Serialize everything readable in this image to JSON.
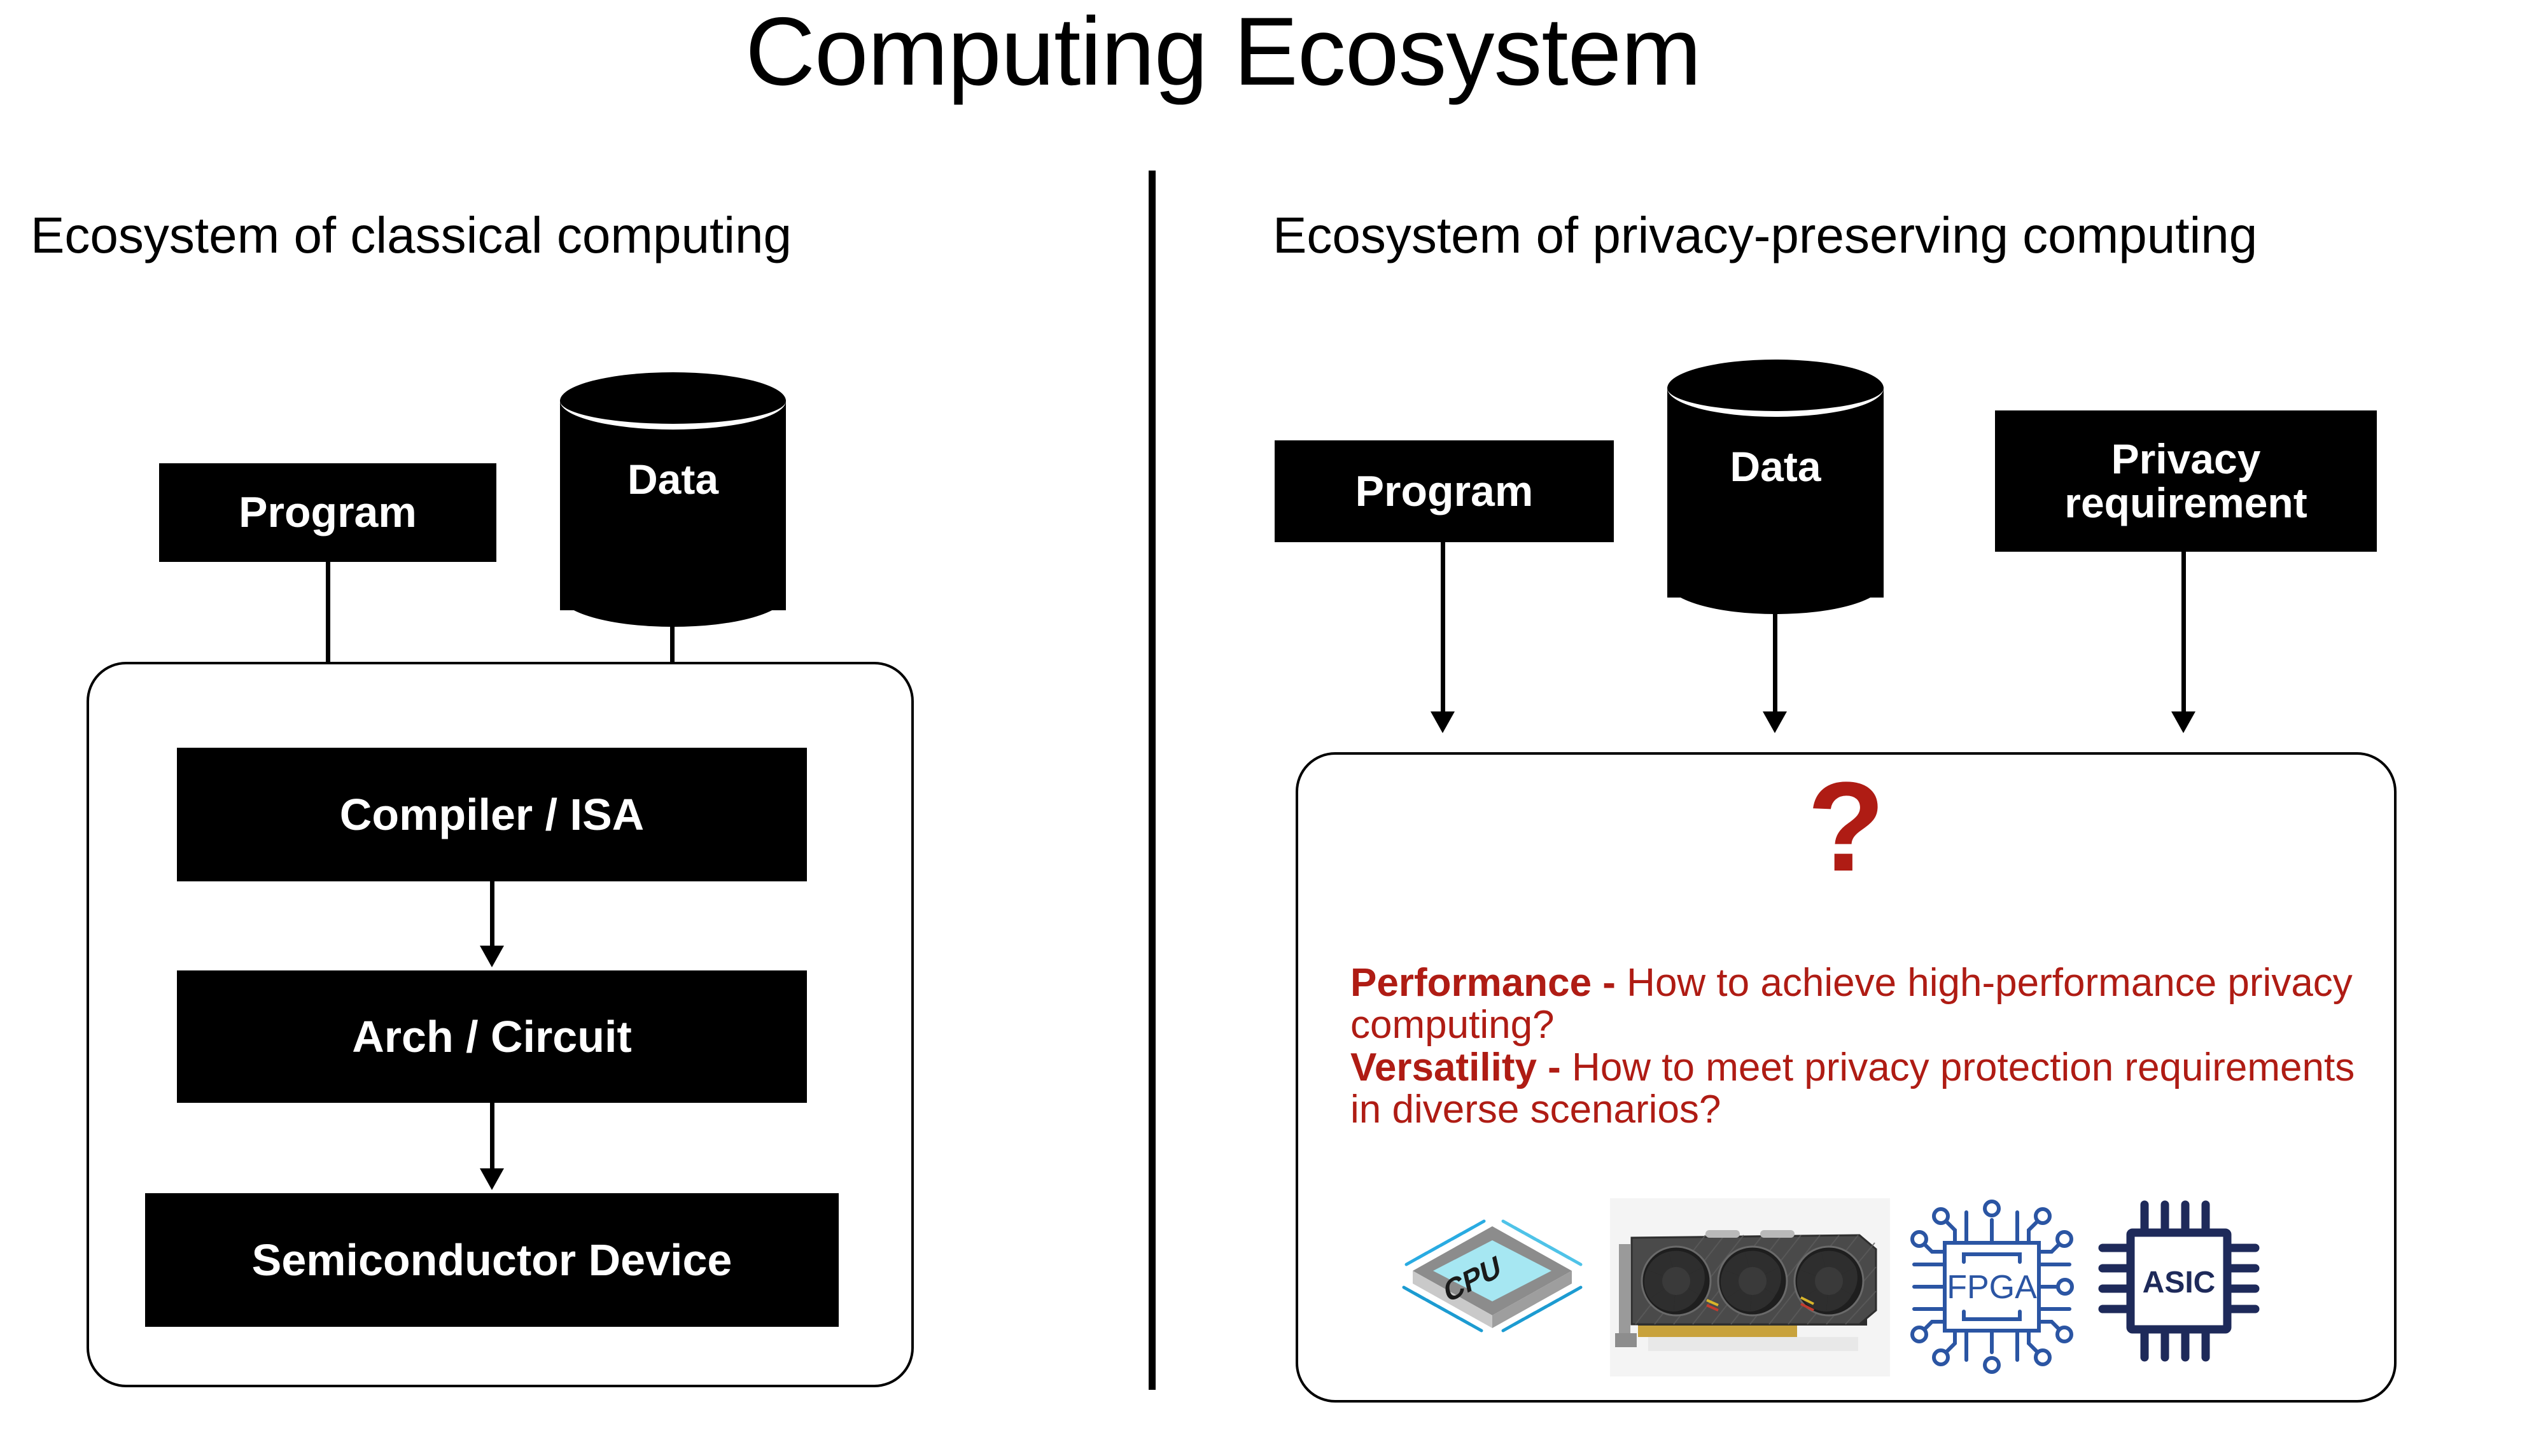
{
  "title": "Computing Ecosystem",
  "divider": {
    "color": "#000000"
  },
  "left_panel": {
    "heading": "Ecosystem of classical computing",
    "inputs": [
      {
        "id": "program",
        "label": "Program",
        "shape": "rectangle"
      },
      {
        "id": "data",
        "label": "Data",
        "shape": "cylinder"
      }
    ],
    "stack": [
      {
        "id": "compiler",
        "label": "Compiler / ISA"
      },
      {
        "id": "arch",
        "label": "Arch / Circuit"
      },
      {
        "id": "semiconductor",
        "label": "Semiconductor Device"
      }
    ]
  },
  "right_panel": {
    "heading": "Ecosystem of privacy-preserving computing",
    "inputs": [
      {
        "id": "program",
        "label": "Program",
        "shape": "rectangle"
      },
      {
        "id": "data",
        "label": "Data",
        "shape": "cylinder"
      },
      {
        "id": "privacy",
        "label": "Privacy\nrequirement",
        "line1": "Privacy",
        "line2": "requirement",
        "shape": "rectangle"
      }
    ],
    "question_mark": "?",
    "accent_color": "#AF1C14",
    "challenges": [
      {
        "term": "Performance -",
        "text": " How to achieve high-performance privacy computing?"
      },
      {
        "term": "Versatility -",
        "text": " How to meet privacy protection requirements in diverse scenarios?"
      }
    ],
    "hardware": [
      {
        "id": "cpu",
        "label": "CPU",
        "icon": "cpu-chip-icon",
        "colors": {
          "die": "#A6E7F2",
          "package": "#8C8C8C",
          "pins": "#29ABE2"
        }
      },
      {
        "id": "gpu",
        "label": "",
        "icon": "graphics-card-photo",
        "colors": {
          "body": "#3C3C3C",
          "fan": "#1E1E1E"
        }
      },
      {
        "id": "fpga",
        "label": "FPGA",
        "icon": "fpga-chip-icon",
        "colors": {
          "stroke": "#2B55A3"
        }
      },
      {
        "id": "asic",
        "label": "ASIC",
        "icon": "asic-chip-icon",
        "colors": {
          "stroke": "#1E2A5A"
        }
      }
    ]
  }
}
